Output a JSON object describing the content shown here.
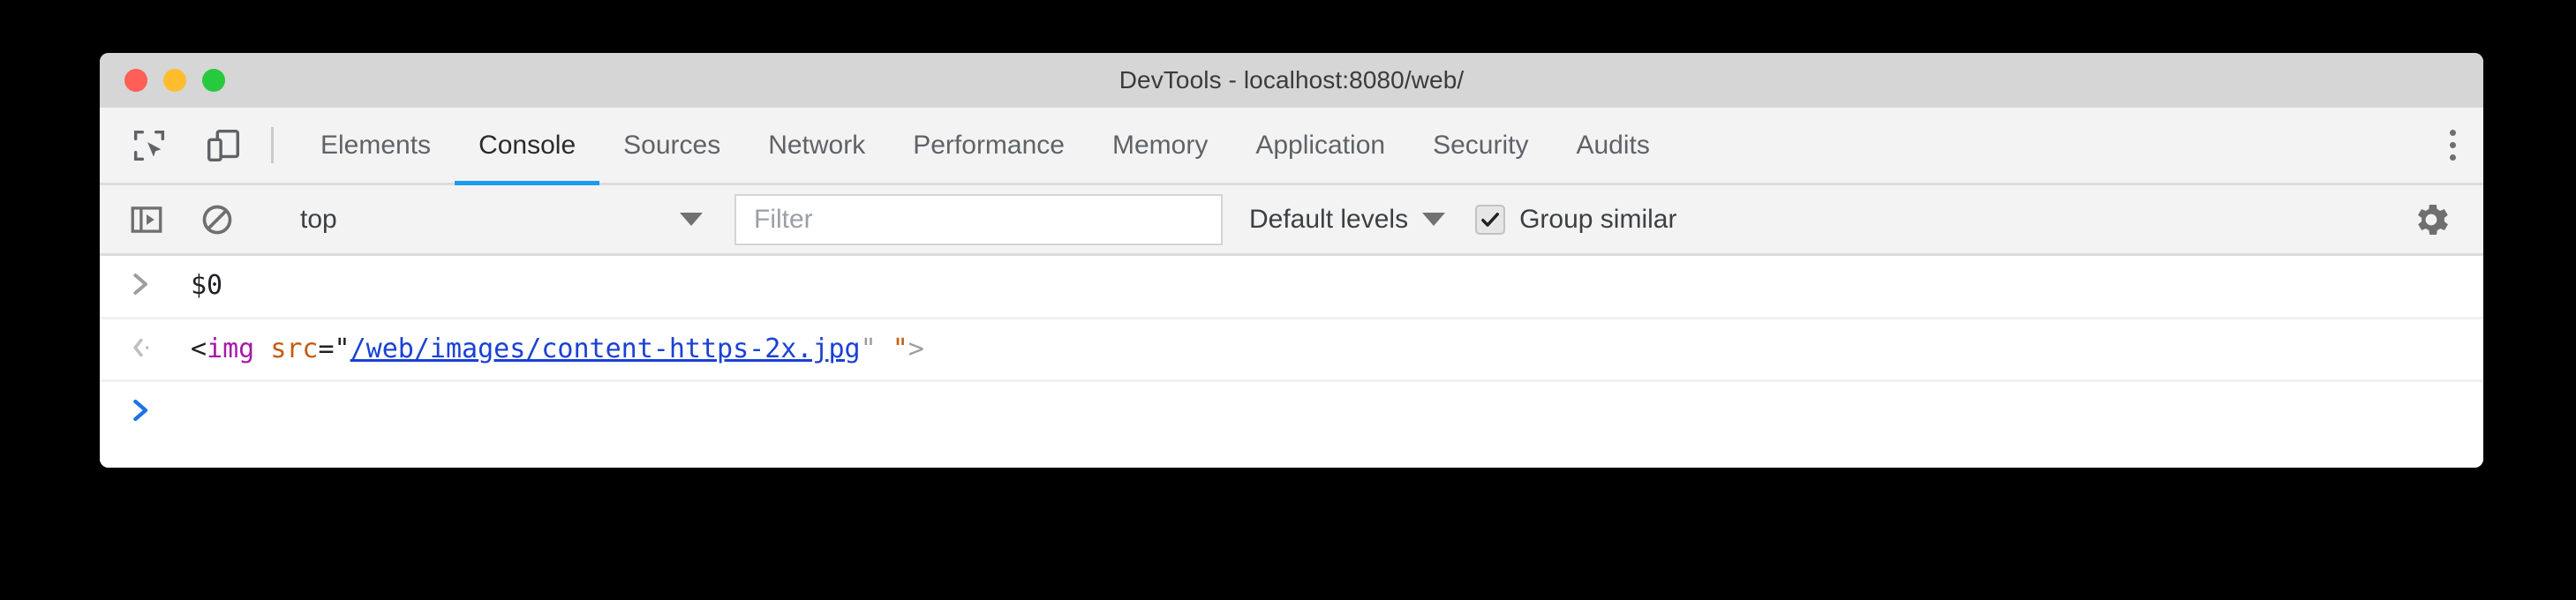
{
  "window": {
    "title": "DevTools - localhost:8080/web/",
    "traffic_lights": [
      {
        "name": "close",
        "color": "#ff5f56"
      },
      {
        "name": "minimize",
        "color": "#ffbd2e"
      },
      {
        "name": "zoom",
        "color": "#27c93f"
      }
    ]
  },
  "tabbar": {
    "icons": [
      {
        "name": "inspect-element-icon",
        "title": "Inspect element"
      },
      {
        "name": "device-toolbar-icon",
        "title": "Toggle device toolbar"
      }
    ],
    "tabs": [
      {
        "label": "Elements",
        "active": false
      },
      {
        "label": "Console",
        "active": true
      },
      {
        "label": "Sources",
        "active": false
      },
      {
        "label": "Network",
        "active": false
      },
      {
        "label": "Performance",
        "active": false
      },
      {
        "label": "Memory",
        "active": false
      },
      {
        "label": "Application",
        "active": false
      },
      {
        "label": "Security",
        "active": false
      },
      {
        "label": "Audits",
        "active": false
      }
    ],
    "more_menu": "more-vertical-icon",
    "active_underline_color": "#1a9bf0"
  },
  "toolbar": {
    "sidebar_toggle": "console-sidebar-icon",
    "clear_console": "clear-console-icon",
    "context": {
      "value": "top",
      "caret": "chevron-down-icon"
    },
    "filter": {
      "value": "",
      "placeholder": "Filter"
    },
    "levels": {
      "label": "Default levels",
      "caret": "chevron-down-icon"
    },
    "group_similar": {
      "label": "Group similar",
      "checked": true,
      "check_glyph": "✔"
    },
    "settings": "gear-icon"
  },
  "console": {
    "lines": [
      {
        "type": "input",
        "prompt": "❯",
        "prompt_color": "#9e9e9e",
        "text": "$0"
      },
      {
        "type": "output",
        "prompt": "‹·",
        "prompt_color": "#bdbdbd",
        "tokens": [
          {
            "text": "<",
            "style": "plain"
          },
          {
            "text": "img",
            "style": "tag"
          },
          {
            "text": " ",
            "style": "plain"
          },
          {
            "text": "src",
            "style": "attr"
          },
          {
            "text": "=\"",
            "style": "plain"
          },
          {
            "text": "/web/images/content-https-2x.jpg",
            "style": "link"
          },
          {
            "text": "\"",
            "style": "quote-grey"
          },
          {
            "text": " ",
            "style": "plain"
          },
          {
            "text": "\"",
            "style": "attr"
          },
          {
            "text": ">",
            "style": "grey"
          }
        ]
      },
      {
        "type": "prompt",
        "prompt": "❯",
        "prompt_color": "#1a73e8",
        "text": ""
      }
    ]
  }
}
